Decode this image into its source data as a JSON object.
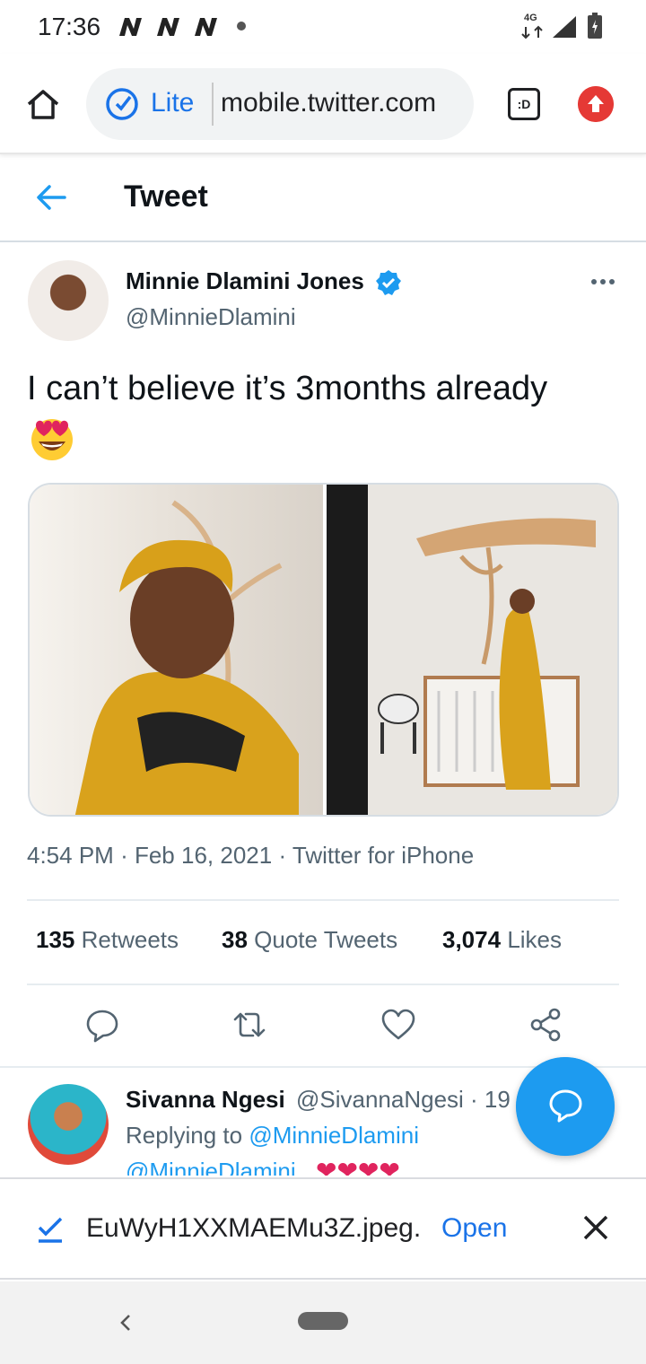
{
  "status_bar": {
    "time": "17:36",
    "network": "4G"
  },
  "browser": {
    "mode_label": "Lite",
    "url": "mobile.twitter.com",
    "tab_label": ":D"
  },
  "header": {
    "title": "Tweet"
  },
  "tweet": {
    "author_name": "Minnie Dlamini Jones",
    "author_handle": "@MinnieDlamini",
    "text": "I can’t believe it’s 3months already",
    "emoji": "heart-eyes-emoji",
    "time": "4:54 PM",
    "date": "Feb 16, 2021",
    "source": "Twitter for iPhone",
    "separator": "·",
    "stats": {
      "retweets_count": "135",
      "retweets_label": "Retweets",
      "quotes_count": "38",
      "quotes_label": "Quote Tweets",
      "likes_count": "3,074",
      "likes_label": "Likes"
    }
  },
  "reply": {
    "name": "Sivanna Ngesi",
    "handle": "@SivannaNgesi · 19",
    "replying_prefix": "Replying to ",
    "replying_to": "@MinnieDlamini",
    "mention": "@MinnieDlamini",
    "emojis": "❤❤❤❤"
  },
  "download": {
    "filename": "EuWyH1XXMAEMu3Z.jpeg.",
    "open_label": "Open"
  },
  "colors": {
    "accent": "#1d9bf0",
    "text_secondary": "#536471",
    "browser_accent": "#1a73e8",
    "upload_red": "#e53935"
  }
}
